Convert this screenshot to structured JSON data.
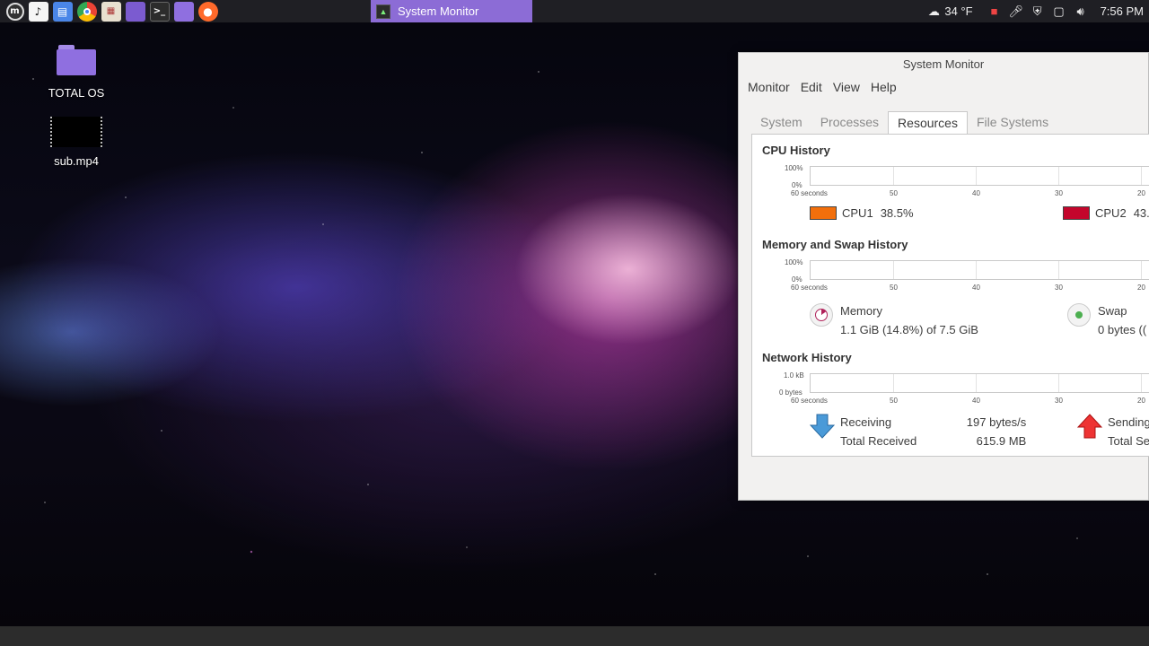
{
  "taskbar": {
    "task_title": "System Monitor",
    "weather": "34 °F",
    "clock": "7:56 PM",
    "launchers": [
      "mint-menu-icon",
      "music-icon",
      "files-icon",
      "chrome-icon",
      "calendar-icon",
      "purple-window-icon",
      "terminal-icon",
      "folder-icon",
      "firefox-icon"
    ]
  },
  "desktop": {
    "icons": [
      {
        "label": "TOTAL OS"
      },
      {
        "label": "sub.mp4"
      }
    ]
  },
  "window": {
    "title": "System Monitor",
    "menu": [
      "Monitor",
      "Edit",
      "View",
      "Help"
    ],
    "tabs": [
      "System",
      "Processes",
      "Resources",
      "File Systems"
    ],
    "active_tab": "Resources",
    "cpu": {
      "title": "CPU History",
      "y_top": "100%",
      "y_bottom": "0%",
      "x_ticks": [
        "60 seconds",
        "50",
        "40",
        "30",
        "20"
      ],
      "cpu1_label": "CPU1",
      "cpu1_value": "38.5%",
      "cpu2_label": "CPU2",
      "cpu2_value": "43.",
      "cpu1_color": "#f26f0c",
      "cpu2_color": "#c4062c"
    },
    "memory": {
      "title": "Memory and Swap History",
      "y_top": "100%",
      "y_bottom": "0%",
      "x_ticks": [
        "60 seconds",
        "50",
        "40",
        "30",
        "20"
      ],
      "memory_label": "Memory",
      "memory_value": "1.1 GiB (14.8%) of 7.5 GiB",
      "swap_label": "Swap",
      "swap_value": "0 bytes (("
    },
    "network": {
      "title": "Network History",
      "y_top": "1.0 kB",
      "y_bottom": "0 bytes",
      "x_ticks": [
        "60 seconds",
        "50",
        "40",
        "30",
        "20"
      ],
      "receiving_label": "Receiving",
      "receiving_rate": "197 bytes/s",
      "total_received_label": "Total Received",
      "total_received": "615.9 MB",
      "sending_label": "Sending",
      "total_sent_label": "Total Se"
    }
  }
}
